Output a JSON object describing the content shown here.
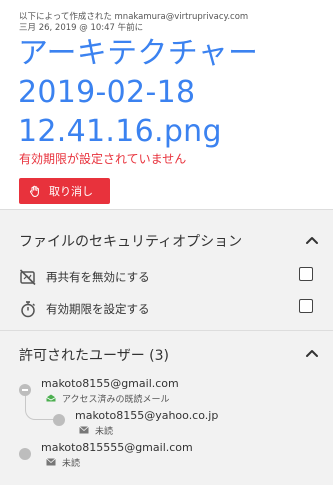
{
  "header": {
    "created_by": "以下によって作成された mnakamura@virtruprivacy.com",
    "created_at": "三月 26, 2019 @ 10:47 午前に",
    "file_title_lines": [
      "アーキテクチャー",
      "2019-02-18",
      "12.41.16.png"
    ],
    "expiry_warning": "有効期限が設定されていません",
    "revoke_label": "取り消し"
  },
  "security": {
    "title": "ファイルのセキュリティオプション",
    "options": [
      {
        "label": "再共有を無効にする",
        "icon": "no-reshare-icon",
        "checked": false
      },
      {
        "label": "有効期限を設定する",
        "icon": "stopwatch-icon",
        "checked": false
      }
    ]
  },
  "users": {
    "title": "許可されたユーザー (3)",
    "list": [
      {
        "email": "makoto8155@gmail.com",
        "status": "アクセス済みの既読メール",
        "status_icon": "open-envelope-icon"
      },
      {
        "email": "makoto8155@yahoo.co.jp",
        "status": "未読",
        "status_icon": "envelope-icon"
      },
      {
        "email": "makoto815555@gmail.com",
        "status": "未読",
        "status_icon": "envelope-icon"
      }
    ]
  },
  "colors": {
    "accent_blue": "#3b82f0",
    "warning_red": "#e8323c",
    "read_green": "#4caf50"
  }
}
